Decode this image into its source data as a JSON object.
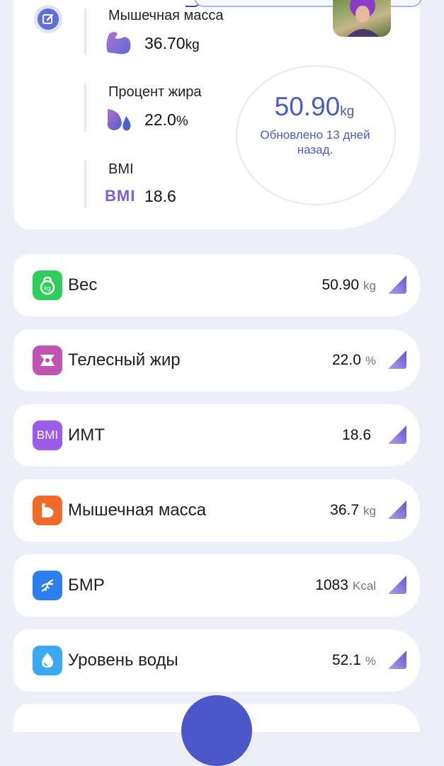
{
  "summary": {
    "muscle": {
      "title": "Мышечная масса",
      "value": "36.70",
      "unit": "kg"
    },
    "fat": {
      "title": "Процент жира",
      "value": "22.0",
      "unit": "%"
    },
    "bmi": {
      "title": "BMI",
      "icon_text": "BMI",
      "value": "18.6"
    },
    "weight": {
      "value": "50.90",
      "unit": "kg",
      "updated": "Обновлено 13 дней назад."
    }
  },
  "rows": [
    {
      "label": "Вес",
      "value": "50.90",
      "unit": "kg",
      "icon": "kettlebell-icon",
      "color": "#2fcd5c"
    },
    {
      "label": "Телесный жир",
      "value": "22.0",
      "unit": "%",
      "icon": "body-fat-icon",
      "color": "#c054b3"
    },
    {
      "label": "ИМТ",
      "value": "18.6",
      "unit": "",
      "icon": "bmi-icon",
      "icon_text": "BMI",
      "color": "#9b5ce8"
    },
    {
      "label": "Мышечная масса",
      "value": "36.7",
      "unit": "kg",
      "icon": "muscle-icon",
      "color": "#f26a2a"
    },
    {
      "label": "БМР",
      "value": "1083",
      "unit": "Kcal",
      "icon": "dna-icon",
      "color": "#2d7ff0"
    },
    {
      "label": "Уровень воды",
      "value": "52.1",
      "unit": "%",
      "icon": "water-drop-icon",
      "color": "#3aa9f2"
    }
  ],
  "colors": {
    "accent": "#4a5cc0",
    "background": "#eceef8"
  }
}
